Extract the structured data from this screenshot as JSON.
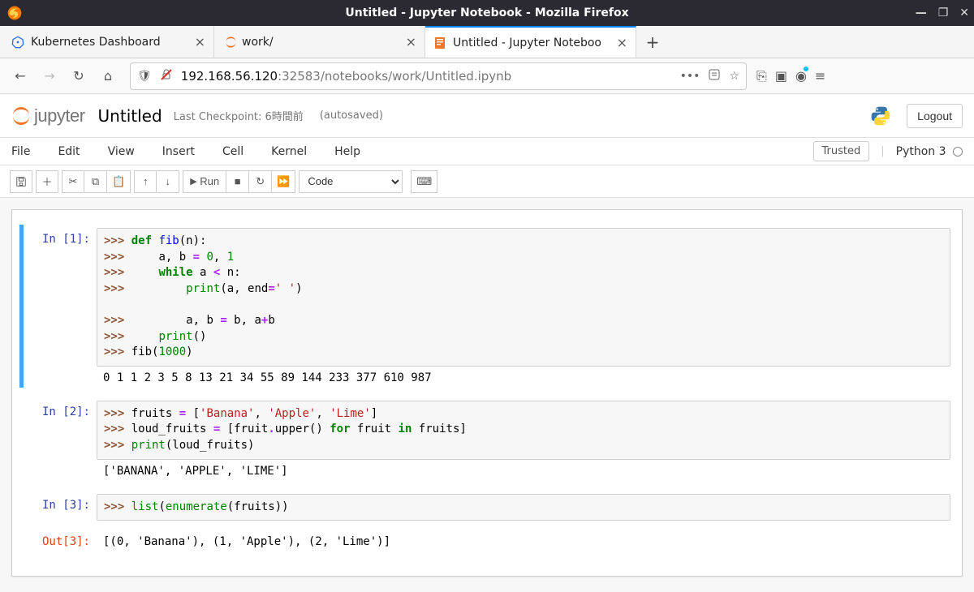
{
  "window": {
    "title": "Untitled - Jupyter Notebook - Mozilla Firefox"
  },
  "tabs": [
    {
      "title": "Kubernetes Dashboard"
    },
    {
      "title": "work/"
    },
    {
      "title": "Untitled - Jupyter Noteboo"
    }
  ],
  "address": {
    "host": "192.168.56.120",
    "rest": ":32583/notebooks/work/Untitled.ipynb"
  },
  "jupyter": {
    "logo_text": "jupyter",
    "nb_title": "Untitled",
    "checkpoint": "Last Checkpoint: 6時間前",
    "autosaved": "(autosaved)",
    "logout": "Logout",
    "trusted": "Trusted",
    "kernel": "Python 3"
  },
  "menus": {
    "file": "File",
    "edit": "Edit",
    "view": "View",
    "insert": "Insert",
    "cell": "Cell",
    "kernel": "Kernel",
    "help": "Help"
  },
  "toolbar": {
    "run": "Run",
    "celltype": "Code"
  },
  "cells": [
    {
      "in_prompt": "In [1]:",
      "output": "0 1 1 2 3 5 8 13 21 34 55 89 144 233 377 610 987"
    },
    {
      "in_prompt": "In [2]:",
      "output": "['BANANA', 'APPLE', 'LIME']"
    },
    {
      "in_prompt": "In [3]:",
      "out_prompt": "Out[3]:",
      "output": "[(0, 'Banana'), (1, 'Apple'), (2, 'Lime')]"
    }
  ],
  "code": {
    "c1_l1a": ">>> ",
    "c1_l1_def": "def ",
    "c1_l1_fn": "fib",
    "c1_l1_rest": "(n):",
    "c1_l2a": ">>>     ",
    "c1_l2_rest": "a, b ",
    "c1_l2_op": "=",
    "c1_l2_rest2": " ",
    "c1_l2_n1": "0",
    "c1_l2_c": ", ",
    "c1_l2_n2": "1",
    "c1_l3a": ">>>     ",
    "c1_l3_while": "while ",
    "c1_l3_rest": "a ",
    "c1_l3_op": "<",
    "c1_l3_rest2": " n:",
    "c1_l4a": ">>>         ",
    "c1_l4_print": "print",
    "c1_l4_rest": "(a, end",
    "c1_l4_op": "=",
    "c1_l4_str": "' '",
    "c1_l4_rest2": ")",
    "c1_l5a": "",
    "c1_l6a": ">>>         ",
    "c1_l6_rest": "a, b ",
    "c1_l6_op": "=",
    "c1_l6_rest2": " b, a",
    "c1_l6_op2": "+",
    "c1_l6_rest3": "b",
    "c1_l7a": ">>>     ",
    "c1_l7_print": "print",
    "c1_l7_rest": "()",
    "c1_l8a": ">>> ",
    "c1_l8_rest": "fib(",
    "c1_l8_n": "1000",
    "c1_l8_rest2": ")",
    "c2_l1a": ">>> ",
    "c2_l1_rest": "fruits ",
    "c2_l1_op": "=",
    "c2_l1_rest2": " [",
    "c2_l1_s1": "'Banana'",
    "c2_l1_c1": ", ",
    "c2_l1_s2": "'Apple'",
    "c2_l1_c2": ", ",
    "c2_l1_s3": "'Lime'",
    "c2_l1_rest3": "]",
    "c2_l2a": ">>> ",
    "c2_l2_rest": "loud_fruits ",
    "c2_l2_op": "=",
    "c2_l2_rest2": " [fruit",
    "c2_l2_dot": ".",
    "c2_l2_rest3": "upper() ",
    "c2_l2_for": "for",
    "c2_l2_rest4": " fruit ",
    "c2_l2_in": "in",
    "c2_l2_rest5": " fruits]",
    "c2_l3a": ">>> ",
    "c2_l3_print": "print",
    "c2_l3_rest": "(loud_fruits)",
    "c3_l1a": ">>> ",
    "c3_l1_list": "list",
    "c3_l1_rest": "(",
    "c3_l1_enum": "enumerate",
    "c3_l1_rest2": "(fruits))"
  }
}
